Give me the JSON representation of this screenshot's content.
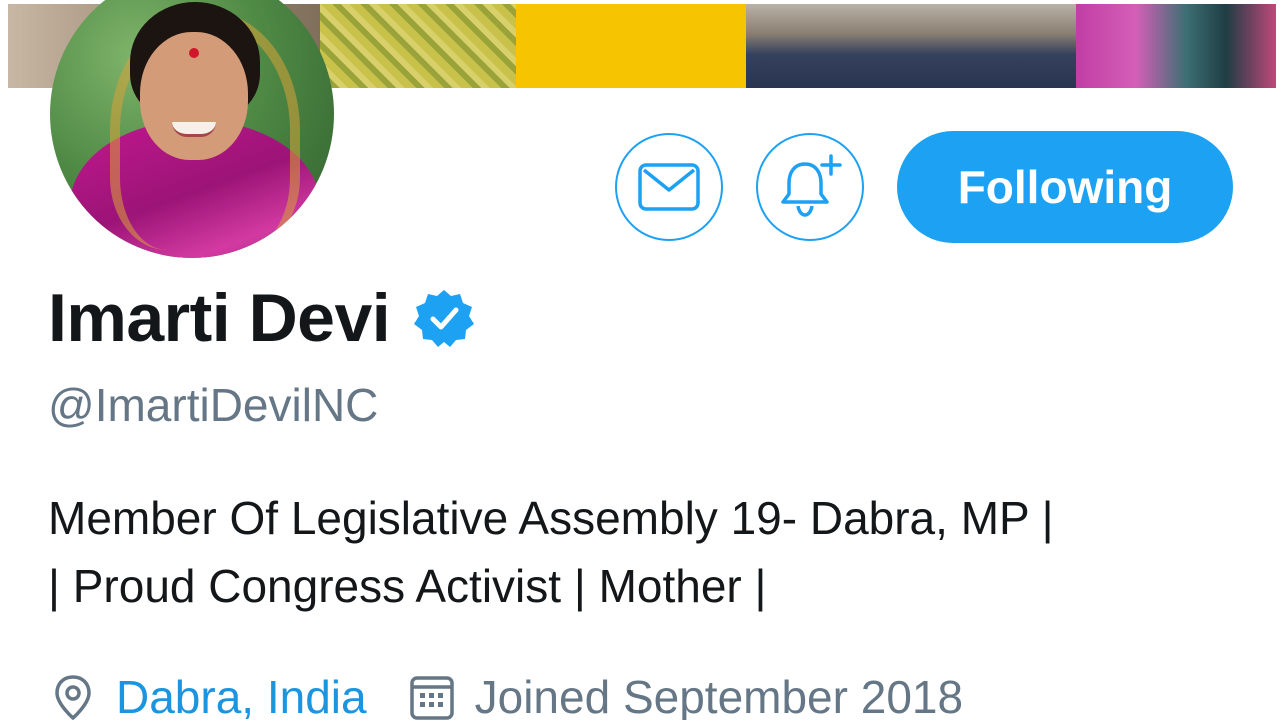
{
  "colors": {
    "accent": "#1da1f2",
    "link": "#1b95e0",
    "text_primary": "#14171a",
    "text_secondary": "#657786",
    "verified_badge": "#1da1f2"
  },
  "profile": {
    "display_name": "Imarti Devi",
    "verified": true,
    "handle": "@ImartiDevilNC",
    "bio_lines": [
      "Member Of Legislative Assembly 19- Dabra, MP |",
      "| Proud Congress Activist | Mother |"
    ],
    "location": "Dabra, India",
    "joined": "Joined September 2018"
  },
  "actions": {
    "message_icon": "envelope-icon",
    "notify_icon": "bell-plus-icon",
    "follow_label": "Following"
  },
  "icons": {
    "verified": "verified-badge-icon",
    "location": "location-pin-icon",
    "calendar": "calendar-icon"
  }
}
